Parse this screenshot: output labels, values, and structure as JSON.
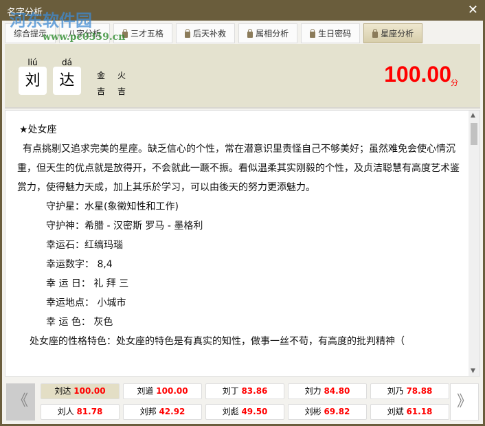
{
  "window": {
    "title": "名字分析",
    "close": "✕"
  },
  "watermark": {
    "line1": "河东软件园",
    "line2": "www.pc0359.cn"
  },
  "tabs": [
    {
      "label": "综合提示",
      "locked": false
    },
    {
      "label": "八字分析",
      "locked": false
    },
    {
      "label": "三才五格",
      "locked": true
    },
    {
      "label": "后天补救",
      "locked": true
    },
    {
      "label": "属相分析",
      "locked": true
    },
    {
      "label": "生日密码",
      "locked": true
    },
    {
      "label": "星座分析",
      "locked": true,
      "active": true
    }
  ],
  "name": {
    "chars": [
      {
        "char": "刘",
        "pinyin": "liú",
        "element": "金",
        "luck": "吉"
      },
      {
        "char": "达",
        "pinyin": "dá",
        "element": "火",
        "luck": "吉"
      }
    ],
    "score": "100.00",
    "unit": "分"
  },
  "content": {
    "heading": "★处女座",
    "paragraph": "有点挑剔又追求完美的星座。缺乏信心的个性，常在潜意识里责怪自己不够美好；虽然难免会使心情沉重，但天生的优点就是放得开，不会就此一蹶不振。看似温柔其实刚毅的个性，及贞洁聪慧有高度艺术鉴赏力，使得魅力天成，加上其乐於学习，可以由後天的努力更添魅力。",
    "facts": [
      "守护星：水星(象徵知性和工作)",
      "守护神：希腊 - 汉密斯 罗马 - 墨格利",
      "幸运石：红缟玛瑙",
      "幸运数字： 8,4",
      "幸 运 日： 礼 拜 三",
      "幸运地点： 小城市",
      "幸 运 色： 灰色"
    ],
    "partial": "处女座的性格特色：处女座的特色是有真实的知性，做事一丝不苟，有高度的批判精神（"
  },
  "nav": {
    "prev": "《",
    "next": "》"
  },
  "candidates": [
    {
      "name": "刘达",
      "score": "100.00",
      "selected": true
    },
    {
      "name": "刘道",
      "score": "100.00"
    },
    {
      "name": "刘丁",
      "score": "83.86"
    },
    {
      "name": "刘力",
      "score": "84.80"
    },
    {
      "name": "刘乃",
      "score": "78.88"
    },
    {
      "name": "刘人",
      "score": "81.78"
    },
    {
      "name": "刘邦",
      "score": "42.92"
    },
    {
      "name": "刘彪",
      "score": "49.50"
    },
    {
      "name": "刘彬",
      "score": "69.82"
    },
    {
      "name": "刘斌",
      "score": "61.18"
    }
  ]
}
